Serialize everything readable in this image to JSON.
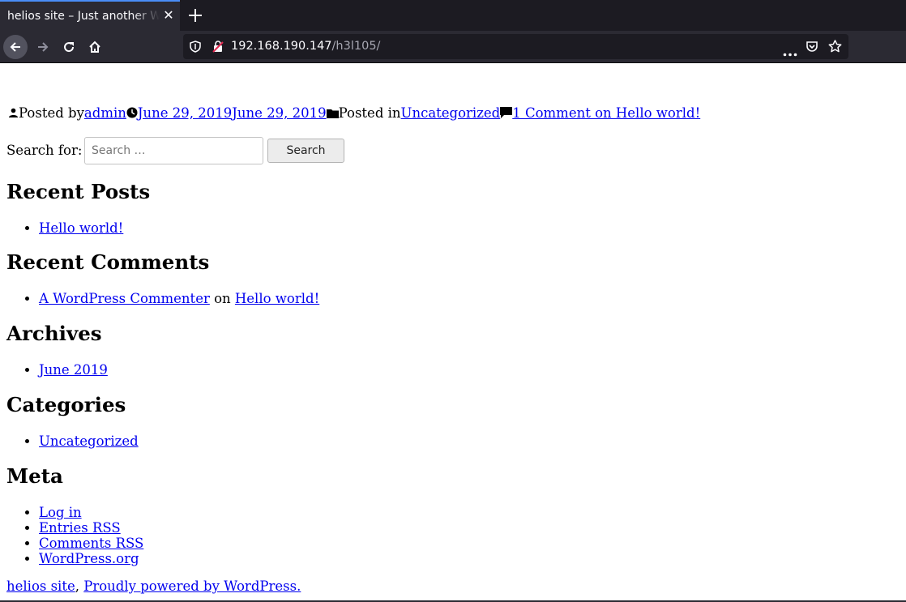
{
  "browser": {
    "tab_title": "helios site – Just another WordPress site",
    "url_host": "192.168.190.147",
    "url_path": "/h3l105/"
  },
  "entry_meta": {
    "posted_by_label": "Posted by",
    "author": "admin",
    "published_date": "June 29, 2019",
    "updated_date": "June 29, 2019",
    "posted_in_label": "Posted in",
    "category": "Uncategorized",
    "comments_link": "1 Comment on Hello world!"
  },
  "search": {
    "label": "Search for:",
    "placeholder": "Search …",
    "button_label": "Search"
  },
  "widgets": {
    "recent_posts": {
      "title": "Recent Posts",
      "items": [
        "Hello world!"
      ]
    },
    "recent_comments": {
      "title": "Recent Comments",
      "author": "A WordPress Commenter",
      "connector": "on",
      "post": "Hello world!"
    },
    "archives": {
      "title": "Archives",
      "items": [
        "June 2019"
      ]
    },
    "categories": {
      "title": "Categories",
      "items": [
        "Uncategorized"
      ]
    },
    "meta": {
      "title": "Meta",
      "items": [
        "Log in",
        "Entries RSS",
        "Comments RSS",
        "WordPress.org"
      ]
    }
  },
  "footer": {
    "site_name": "helios site",
    "separator": ",",
    "powered_by": "Proudly powered by WordPress."
  }
}
